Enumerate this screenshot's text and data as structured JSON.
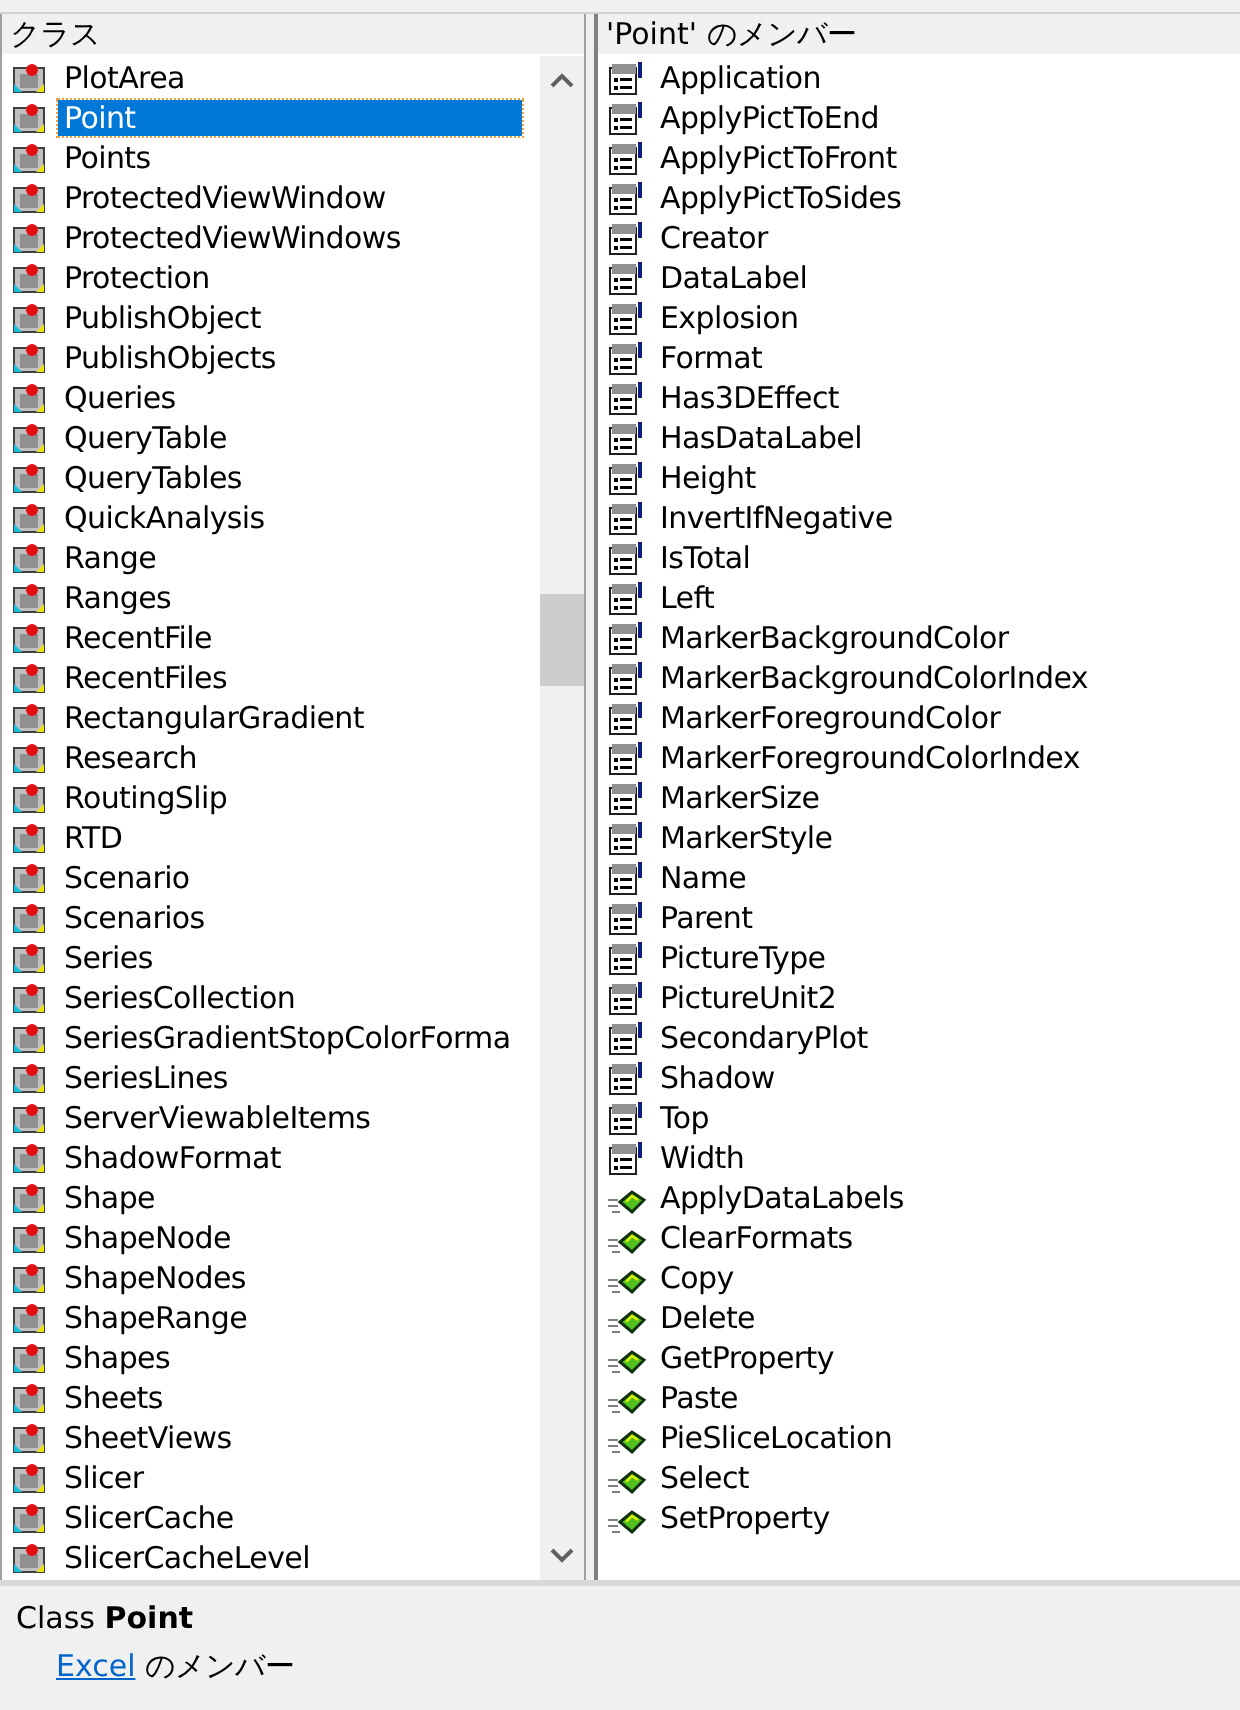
{
  "classes": {
    "header": "クラス",
    "items": [
      {
        "name": "PlotArea",
        "selected": false
      },
      {
        "name": "Point",
        "selected": true
      },
      {
        "name": "Points",
        "selected": false
      },
      {
        "name": "ProtectedViewWindow",
        "selected": false
      },
      {
        "name": "ProtectedViewWindows",
        "selected": false
      },
      {
        "name": "Protection",
        "selected": false
      },
      {
        "name": "PublishObject",
        "selected": false
      },
      {
        "name": "PublishObjects",
        "selected": false
      },
      {
        "name": "Queries",
        "selected": false
      },
      {
        "name": "QueryTable",
        "selected": false
      },
      {
        "name": "QueryTables",
        "selected": false
      },
      {
        "name": "QuickAnalysis",
        "selected": false
      },
      {
        "name": "Range",
        "selected": false
      },
      {
        "name": "Ranges",
        "selected": false
      },
      {
        "name": "RecentFile",
        "selected": false
      },
      {
        "name": "RecentFiles",
        "selected": false
      },
      {
        "name": "RectangularGradient",
        "selected": false
      },
      {
        "name": "Research",
        "selected": false
      },
      {
        "name": "RoutingSlip",
        "selected": false
      },
      {
        "name": "RTD",
        "selected": false
      },
      {
        "name": "Scenario",
        "selected": false
      },
      {
        "name": "Scenarios",
        "selected": false
      },
      {
        "name": "Series",
        "selected": false
      },
      {
        "name": "SeriesCollection",
        "selected": false
      },
      {
        "name": "SeriesGradientStopColorForma",
        "selected": false
      },
      {
        "name": "SeriesLines",
        "selected": false
      },
      {
        "name": "ServerViewableItems",
        "selected": false
      },
      {
        "name": "ShadowFormat",
        "selected": false
      },
      {
        "name": "Shape",
        "selected": false
      },
      {
        "name": "ShapeNode",
        "selected": false
      },
      {
        "name": "ShapeNodes",
        "selected": false
      },
      {
        "name": "ShapeRange",
        "selected": false
      },
      {
        "name": "Shapes",
        "selected": false
      },
      {
        "name": "Sheets",
        "selected": false
      },
      {
        "name": "SheetViews",
        "selected": false
      },
      {
        "name": "Slicer",
        "selected": false
      },
      {
        "name": "SlicerCache",
        "selected": false
      },
      {
        "name": "SlicerCacheLevel",
        "selected": false
      }
    ]
  },
  "members": {
    "header": "'Point' のメンバー",
    "items": [
      {
        "name": "Application",
        "kind": "property"
      },
      {
        "name": "ApplyPictToEnd",
        "kind": "property"
      },
      {
        "name": "ApplyPictToFront",
        "kind": "property"
      },
      {
        "name": "ApplyPictToSides",
        "kind": "property"
      },
      {
        "name": "Creator",
        "kind": "property"
      },
      {
        "name": "DataLabel",
        "kind": "property"
      },
      {
        "name": "Explosion",
        "kind": "property"
      },
      {
        "name": "Format",
        "kind": "property"
      },
      {
        "name": "Has3DEffect",
        "kind": "property"
      },
      {
        "name": "HasDataLabel",
        "kind": "property"
      },
      {
        "name": "Height",
        "kind": "property"
      },
      {
        "name": "InvertIfNegative",
        "kind": "property"
      },
      {
        "name": "IsTotal",
        "kind": "property"
      },
      {
        "name": "Left",
        "kind": "property"
      },
      {
        "name": "MarkerBackgroundColor",
        "kind": "property"
      },
      {
        "name": "MarkerBackgroundColorIndex",
        "kind": "property"
      },
      {
        "name": "MarkerForegroundColor",
        "kind": "property"
      },
      {
        "name": "MarkerForegroundColorIndex",
        "kind": "property"
      },
      {
        "name": "MarkerSize",
        "kind": "property"
      },
      {
        "name": "MarkerStyle",
        "kind": "property"
      },
      {
        "name": "Name",
        "kind": "property"
      },
      {
        "name": "Parent",
        "kind": "property"
      },
      {
        "name": "PictureType",
        "kind": "property"
      },
      {
        "name": "PictureUnit2",
        "kind": "property"
      },
      {
        "name": "SecondaryPlot",
        "kind": "property"
      },
      {
        "name": "Shadow",
        "kind": "property"
      },
      {
        "name": "Top",
        "kind": "property"
      },
      {
        "name": "Width",
        "kind": "property"
      },
      {
        "name": "ApplyDataLabels",
        "kind": "method"
      },
      {
        "name": "ClearFormats",
        "kind": "method"
      },
      {
        "name": "Copy",
        "kind": "method"
      },
      {
        "name": "Delete",
        "kind": "method"
      },
      {
        "name": "GetProperty",
        "kind": "method"
      },
      {
        "name": "Paste",
        "kind": "method"
      },
      {
        "name": "PieSliceLocation",
        "kind": "method"
      },
      {
        "name": "Select",
        "kind": "method"
      },
      {
        "name": "SetProperty",
        "kind": "method"
      }
    ]
  },
  "details": {
    "kind_label": "Class",
    "name": "Point",
    "library": "Excel",
    "suffix": "のメンバー"
  }
}
